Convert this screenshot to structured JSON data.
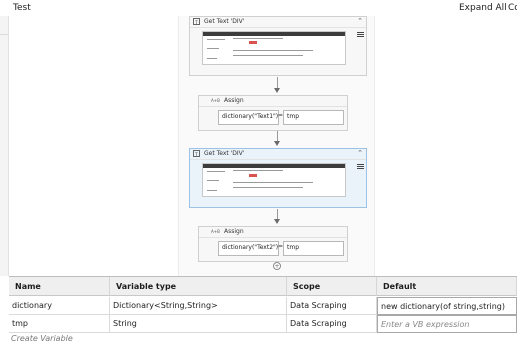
{
  "header": {
    "title": "Test",
    "expand_all": "Expand All",
    "collapse_all": "Co"
  },
  "activities": [
    {
      "type": "get-text",
      "title": "Get Text 'DIV'",
      "icon_text": "T",
      "chevron": "⌃"
    },
    {
      "type": "assign",
      "title": "Assign",
      "icon_text": "A+B",
      "left": "dictionary(\"Text1\")",
      "eq": "=",
      "right": "tmp"
    },
    {
      "type": "get-text",
      "title": "Get Text 'DIV'",
      "icon_text": "T",
      "chevron": "⌃",
      "selected": true
    },
    {
      "type": "assign",
      "title": "Assign",
      "icon_text": "A+B",
      "left": "dictionary(\"Text2\")",
      "eq": "=",
      "right": "tmp"
    }
  ],
  "variables": {
    "headers": [
      "Name",
      "Variable type",
      "Scope",
      "Default"
    ],
    "rows": [
      {
        "name": "dictionary",
        "type": "Dictionary<String,String>",
        "scope": "Data Scraping",
        "default": "new dictionary(of string,string)",
        "default_is_placeholder": false
      },
      {
        "name": "tmp",
        "type": "String",
        "scope": "Data Scraping",
        "default": "Enter a VB expression",
        "default_is_placeholder": true
      }
    ],
    "create_label": "Create Variable"
  },
  "colors": {
    "selection": "#eaf2fa",
    "selection_border": "#9ec2e6",
    "card": "#f7f7f7"
  }
}
